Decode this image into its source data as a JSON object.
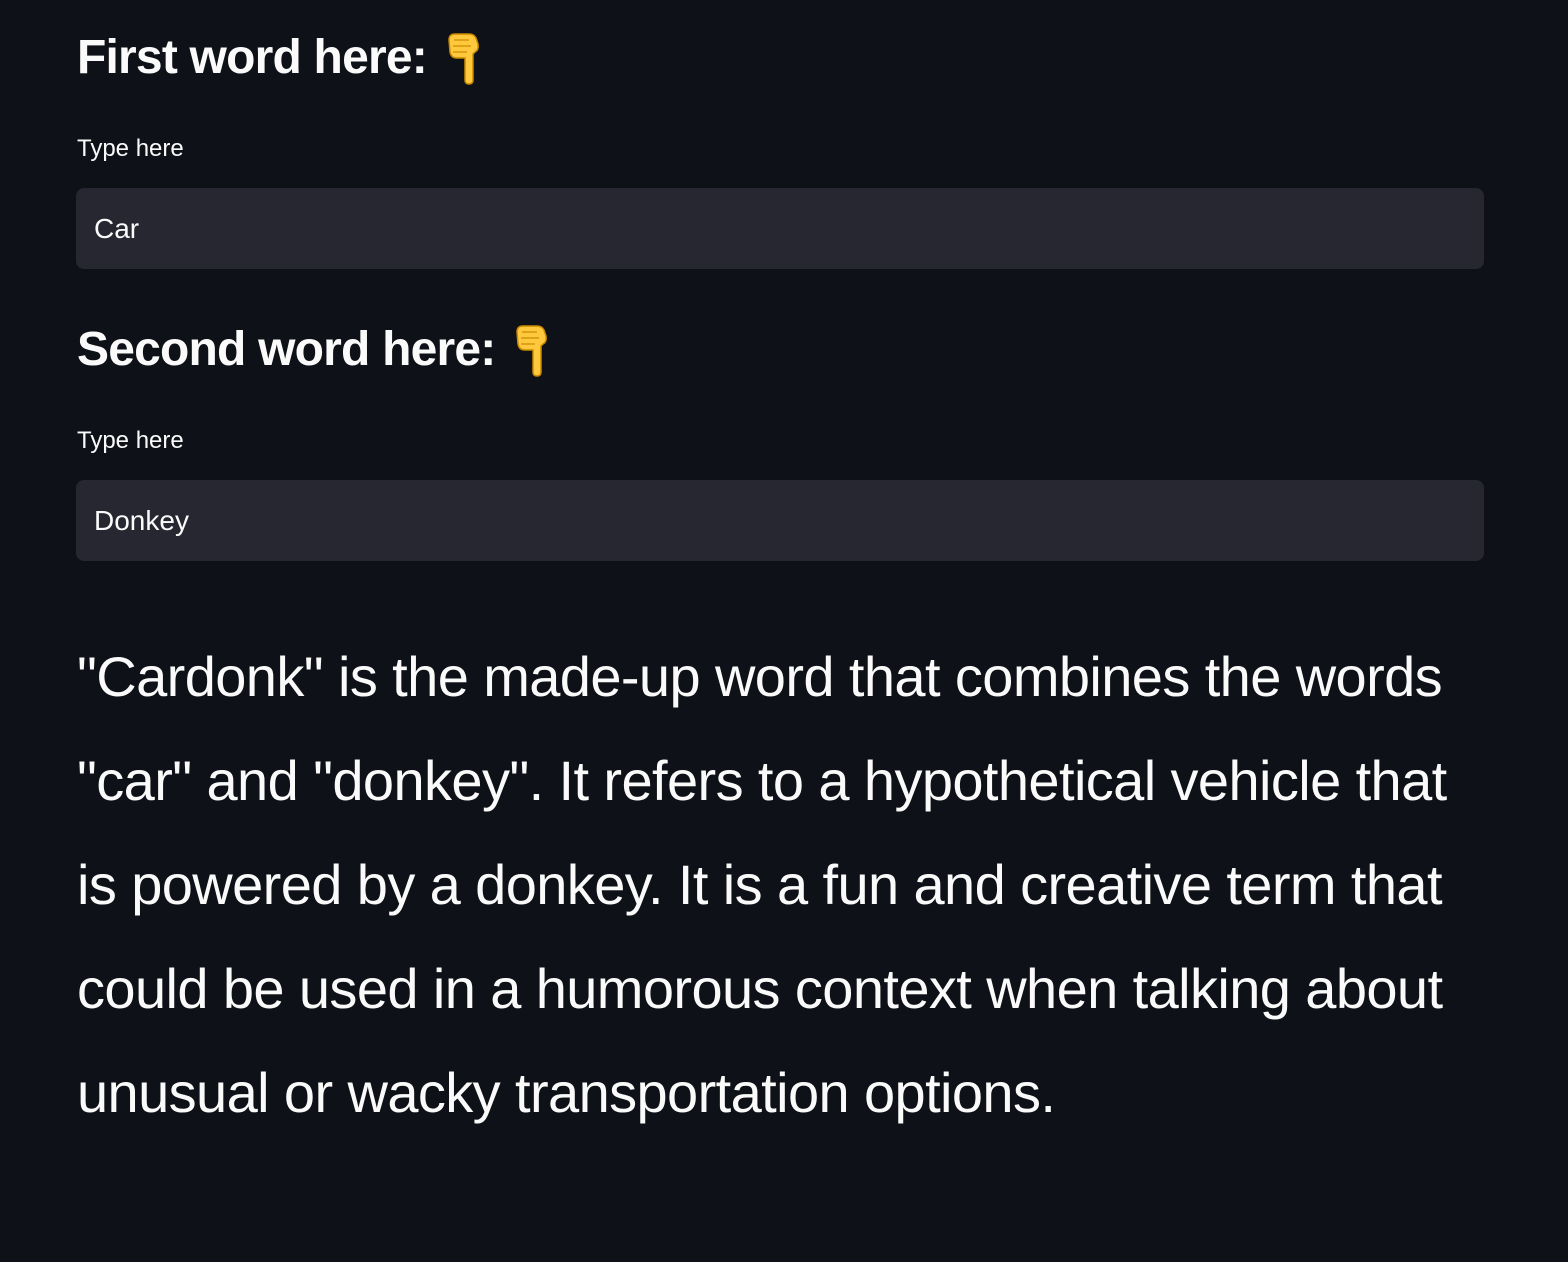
{
  "first_section": {
    "heading": "First word here:",
    "icon": "pointing-down-hand-emoji",
    "label": "Type here",
    "value": "Car"
  },
  "second_section": {
    "heading": "Second word here:",
    "icon": "pointing-down-hand-emoji",
    "label": "Type here",
    "value": "Donkey"
  },
  "result": {
    "text": "\"Cardonk\" is the made-up word that combines the words \"car\" and \"donkey\". It refers to a hypothetical vehicle that is powered by a donkey. It is a fun and creative term that could be used in a humorous context when talking about unusual or wacky transportation options."
  },
  "colors": {
    "background": "#0e1117",
    "input_background": "#262730",
    "text": "#fafafa",
    "emoji_fill": "#ffc83d"
  }
}
